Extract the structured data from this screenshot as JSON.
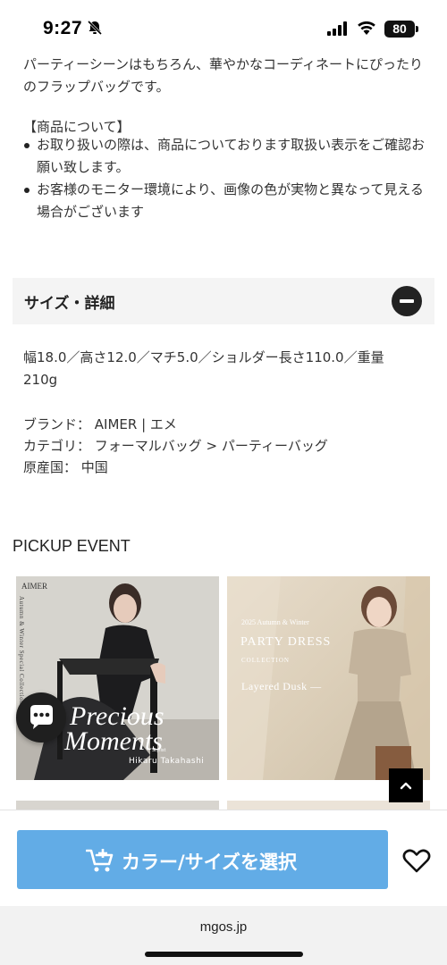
{
  "status_bar": {
    "time": "9:27",
    "battery": "80"
  },
  "description": {
    "intro": "パーティーシーンはもちろん、華やかなコーディネートにぴったりのフラップバッグです。",
    "notice_heading": "【商品について】",
    "bullets": [
      "お取り扱いの際は、商品についております取扱い表示をご確認お願い致します。",
      "お客様のモニター環境により、画像の色が実物と異なって見える場合がございます"
    ]
  },
  "size_section": {
    "title": "サイズ・詳細",
    "specs": "幅18.0／高さ12.0／マチ5.0／ショルダー長さ110.0／重量210g",
    "brand_line": "ブランド： AIMER | エメ",
    "category_line": "カテゴリ： フォーマルバッグ > パーティーバッグ",
    "origin_line": "原産国： 中国"
  },
  "pickup": {
    "title": "PICKUP EVENT",
    "banner1": {
      "brand": "AIMER",
      "subtitle": "Autumn & Winter Special Collection",
      "title_line1": "Precious",
      "title_line2": "Moments",
      "credit_label": "Stylist",
      "credit": "Hikaru Takahashi"
    },
    "banner2": {
      "season": "2025 Autumn & Winter",
      "title": "PARTY DRESS",
      "subtitle": "COLLECTION",
      "tagline": "Layered Dusk —"
    }
  },
  "cta": {
    "select_label": "カラー/サイズを選択"
  },
  "browser": {
    "url": "mgos.jp"
  },
  "colors": {
    "accent": "#62ace6",
    "dark": "#1f1f1f"
  },
  "icons": [
    "bell-off-icon",
    "signal-icon",
    "wifi-icon",
    "battery-icon",
    "minus-icon",
    "chat-icon",
    "chevron-up-icon",
    "cart-add-icon",
    "heart-icon"
  ]
}
